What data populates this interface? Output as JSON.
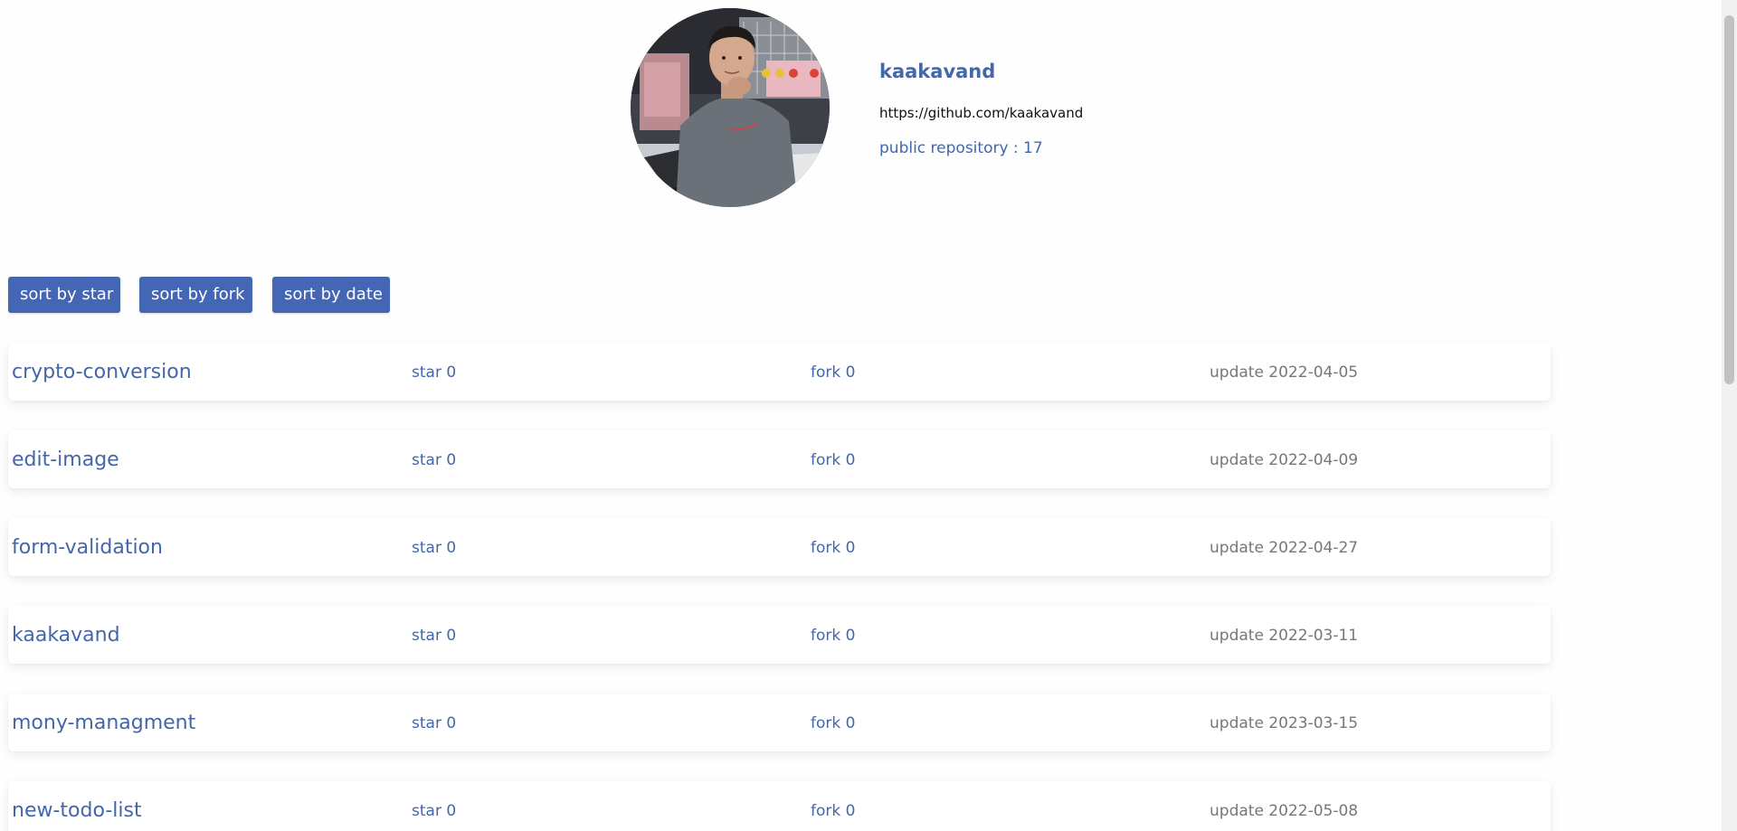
{
  "profile": {
    "username": "kaakavand",
    "url": "https://github.com/kaakavand",
    "repo_count": "public repository : 17",
    "avatar_icon": "profile-photo"
  },
  "sort_buttons": {
    "star": "sort by star",
    "fork": "sort by fork",
    "date": "sort by date"
  },
  "repos": [
    {
      "name": "crypto-conversion",
      "star": "star 0",
      "fork": "fork 0",
      "date": "update 2022-04-05"
    },
    {
      "name": "edit-image",
      "star": "star 0",
      "fork": "fork 0",
      "date": "update 2022-04-09"
    },
    {
      "name": "form-validation",
      "star": "star 0",
      "fork": "fork 0",
      "date": "update 2022-04-27"
    },
    {
      "name": "kaakavand",
      "star": "star 0",
      "fork": "fork 0",
      "date": "update 2022-03-11"
    },
    {
      "name": "mony-managment",
      "star": "star 0",
      "fork": "fork 0",
      "date": "update 2023-03-15"
    },
    {
      "name": "new-todo-list",
      "star": "star 0",
      "fork": "fork 0",
      "date": "update 2022-05-08"
    }
  ],
  "colors": {
    "accent": "#4466b4",
    "link": "#4466aa",
    "muted": "#777777"
  }
}
